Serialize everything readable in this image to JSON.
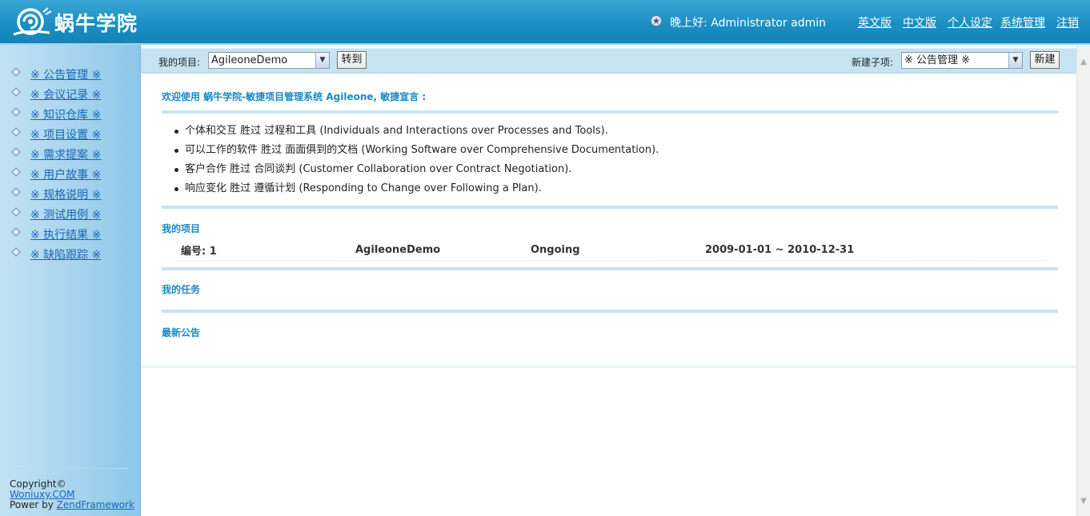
{
  "header": {
    "logo_text": "蜗牛学院",
    "greeting": "晚上好: Administrator admin",
    "links": [
      "英文版",
      "中文版",
      "个人设定",
      "系统管理",
      "注销"
    ]
  },
  "sidebar": {
    "items": [
      "※ 公告管理 ※",
      "※ 会议记录 ※",
      "※ 知识仓库 ※",
      "※ 项目设置 ※",
      "※ 需求提案 ※",
      "※ 用户故事 ※",
      "※ 规格说明 ※",
      "※ 测试用例 ※",
      "※ 执行结果 ※",
      "※ 缺陷跟踪 ※"
    ],
    "footer": {
      "copyright": "Copyright©",
      "site_link": "Woniuxy.COM",
      "powered_prefix": "Power by ",
      "framework_link": "ZendFramework"
    }
  },
  "toolbar": {
    "project_label": "我的项目:",
    "project_value": "AgileoneDemo",
    "goto_label": "转到",
    "new_item_label": "新建子项:",
    "new_item_value": "※ 公告管理 ※",
    "new_button_label": "新建"
  },
  "content": {
    "welcome_title": "欢迎使用 蜗牛学院-敏捷项目管理系统 Agileone, 敏捷宣言 :",
    "manifesto": [
      "个体和交互  胜过  过程和工具   (Individuals and Interactions  over  Processes and Tools).",
      "可以工作的软件  胜过  面面俱到的文档   (Working Software  over  Comprehensive Documentation).",
      "客户合作   胜过  合同谈判   (Customer Collaboration  over  Contract Negotiation).",
      "响应变化  胜过  遵循计划   (Responding to Change  over  Following a Plan)."
    ],
    "my_projects_title": "我的项目",
    "project_row": {
      "id": "编号: 1",
      "name": "AgileoneDemo",
      "status": "Ongoing",
      "dates": "2009-01-01 ~ 2010-12-31"
    },
    "my_tasks_title": "我的任务",
    "latest_news_title": "最新公告"
  },
  "colors": {
    "header_blue": "#1b8fc3",
    "sidebar_blue": "#a6d4ee",
    "link_blue": "#1a66b5",
    "section_title": "#1b8ac2",
    "toolbar_bg": "#c6e3f2"
  },
  "icons": {
    "logo": "snail-logo-icon",
    "greeting": "user-star-icon",
    "nav_bullet": "diamond-bullet-icon",
    "dropdown": "chevron-down-icon"
  }
}
